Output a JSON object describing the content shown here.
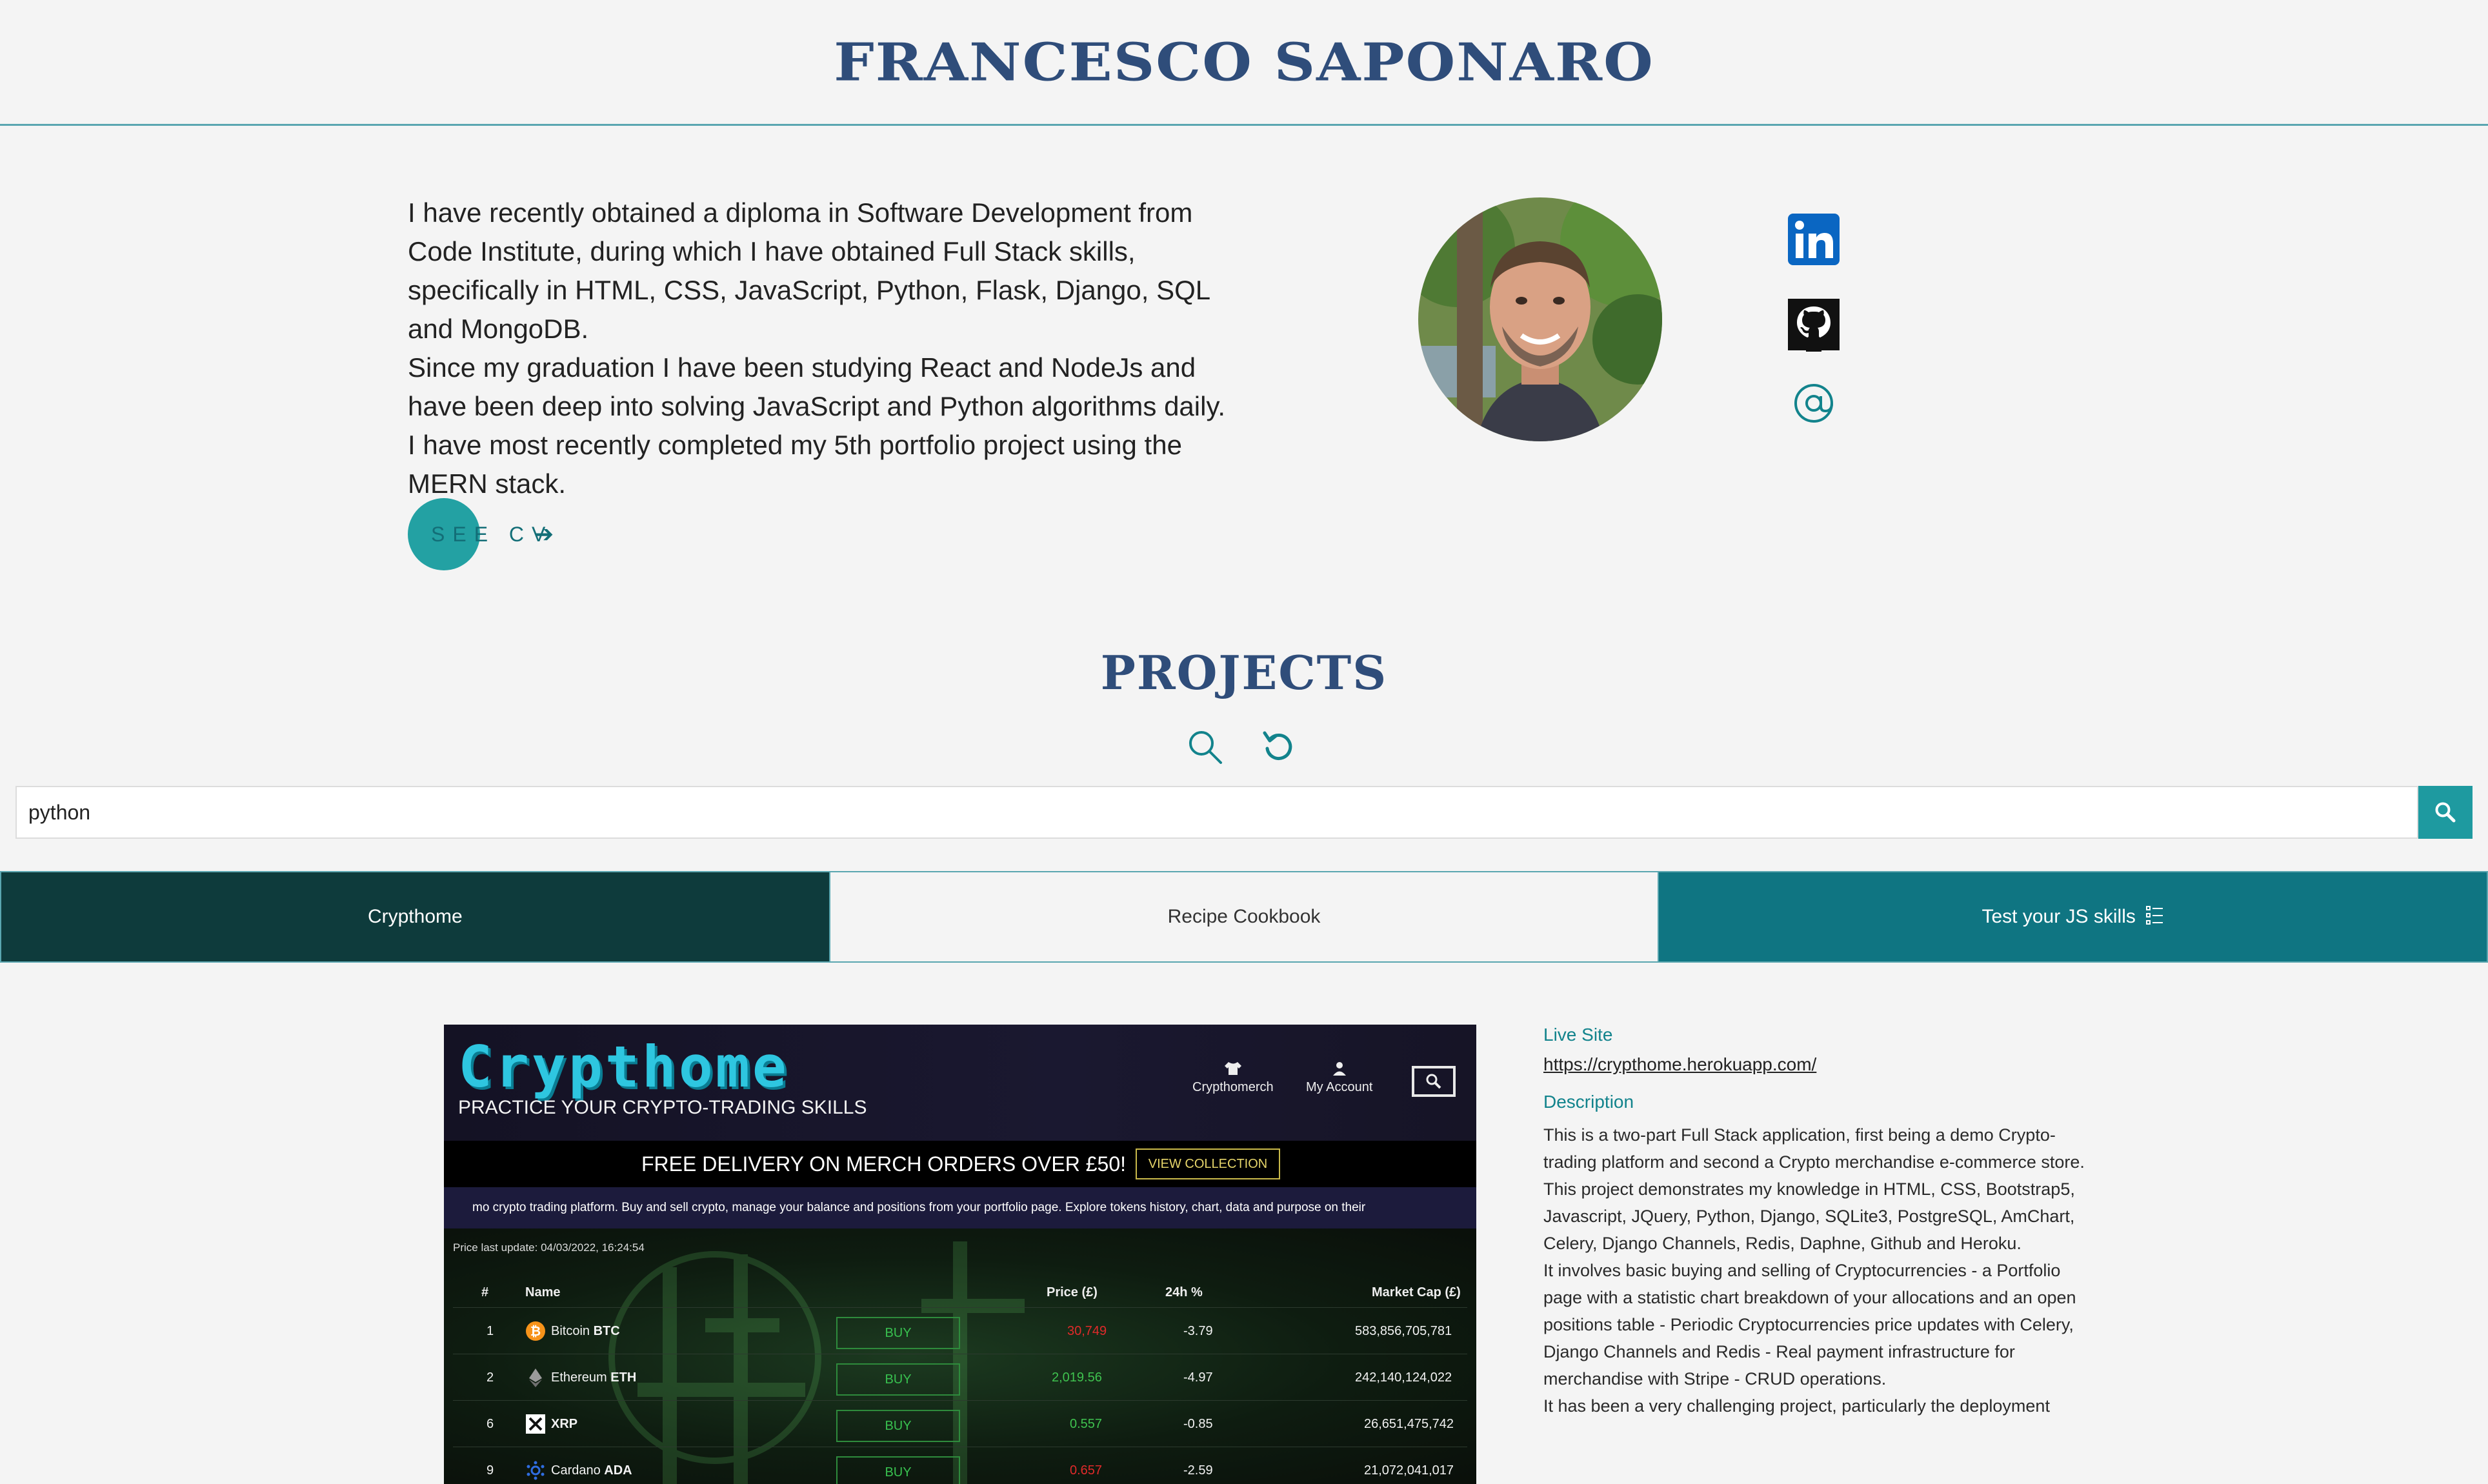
{
  "header": {
    "title": "FRANCESCO SAPONARO"
  },
  "about": {
    "paragraphs": [
      "I have recently obtained a diploma in Software Development from Code Institute, during which I have obtained Full Stack skills, specifically in HTML, CSS, JavaScript, Python, Flask, Django, SQL and MongoDB.",
      "Since my graduation I have been studying React and NodeJs and have been deep into solving JavaScript and Python algorithms daily.",
      "I have most recently completed my 5th portfolio project using the MERN stack."
    ],
    "cv_label": "SEE CV",
    "cv_arrow": "➔"
  },
  "social": {
    "linkedin_color": "#0a66c2",
    "github_color": "#111111",
    "email_color": "#12838c"
  },
  "projects": {
    "title": "PROJECTS",
    "search": {
      "value": "python"
    },
    "tabs": [
      "Crypthome",
      "Recipe Cookbook",
      "Test your JS skills"
    ],
    "colors": {
      "accent": "#1e9aa0",
      "tab_active": "#0e3b3c",
      "tab_third": "#0f7582",
      "title": "#2f4d7a"
    }
  },
  "preview": {
    "logo": "Crypthome",
    "tagline": "PRACTICE YOUR CRYPTO-TRADING SKILLS",
    "nav": [
      "Crypthomerch",
      "My Account"
    ],
    "banner": "FREE DELIVERY ON MERCH ORDERS OVER £50!",
    "banner_button": "VIEW COLLECTION",
    "info": "mo crypto trading platform. Buy and sell crypto, manage your balance and positions from your portfolio page. Explore tokens history, chart, data and purpose on their",
    "price_update": "Price last update: 04/03/2022, 16:24:54",
    "table": {
      "headers": [
        "#",
        "Name",
        "Price (£)",
        "24h %",
        "Market Cap (£)"
      ],
      "buy_label": "BUY",
      "rows": [
        {
          "rank": "1",
          "name": "Bitcoin",
          "symbol": "BTC",
          "price": "30,749",
          "change": "-3.79",
          "cap": "583,856,705,781",
          "price_color": "red",
          "icon_color": "#f7931a"
        },
        {
          "rank": "2",
          "name": "Ethereum",
          "symbol": "ETH",
          "price": "2,019.56",
          "change": "-4.97",
          "cap": "242,140,124,022",
          "price_color": "green",
          "icon_color": "#8c8c8c"
        },
        {
          "rank": "6",
          "name": "XRP",
          "symbol": "XRP",
          "price": "0.557",
          "change": "-0.85",
          "cap": "26,651,475,742",
          "price_color": "green",
          "icon_color": "#ffffff"
        },
        {
          "rank": "9",
          "name": "Cardano",
          "symbol": "ADA",
          "price": "0.657",
          "change": "-2.59",
          "cap": "21,072,041,017",
          "price_color": "red",
          "icon_color": "#2f6de1"
        }
      ]
    }
  },
  "details": {
    "live_label": "Live Site",
    "live_url": "https://crypthome.herokuapp.com/",
    "description_label": "Description",
    "description": [
      "This is a two-part Full Stack application, first being a demo Crypto-trading platform and second a Crypto merchandise e-commerce store.",
      "This project demonstrates my knowledge in HTML, CSS, Bootstrap5, Javascript, JQuery, Python, Django, SQLite3, PostgreSQL, AmChart, Celery, Django Channels, Redis, Daphne, Github and Heroku.",
      "It involves basic buying and selling of Cryptocurrencies - a Portfolio page with a statistic chart breakdown of your allocations and an open positions table - Periodic Cryptocurrencies price updates with Celery, Django Channels and Redis - Real payment infrastructure for merchandise with Stripe - CRUD operations.",
      "It has been a very challenging project, particularly the deployment"
    ]
  }
}
